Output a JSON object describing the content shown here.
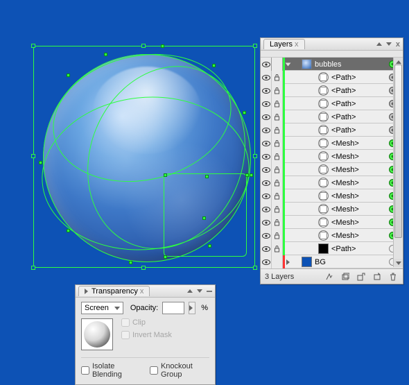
{
  "layers_panel": {
    "title": "Layers",
    "footer_count": "3 Layers",
    "top_layer": {
      "name": "bubbles"
    },
    "sublayers": [
      {
        "name": "<Path>",
        "thumb": "wire",
        "target": "grey"
      },
      {
        "name": "<Path>",
        "thumb": "wire",
        "target": "grey"
      },
      {
        "name": "<Path>",
        "thumb": "wire",
        "target": "grey"
      },
      {
        "name": "<Path>",
        "thumb": "wire",
        "target": "grey"
      },
      {
        "name": "<Path>",
        "thumb": "wire",
        "target": "grey"
      },
      {
        "name": "<Mesh>",
        "thumb": "wire",
        "target": "green"
      },
      {
        "name": "<Mesh>",
        "thumb": "wire",
        "target": "green"
      },
      {
        "name": "<Mesh>",
        "thumb": "wire",
        "target": "green"
      },
      {
        "name": "<Mesh>",
        "thumb": "wire",
        "target": "green"
      },
      {
        "name": "<Mesh>",
        "thumb": "wire",
        "target": "green"
      },
      {
        "name": "<Mesh>",
        "thumb": "wire",
        "target": "green"
      },
      {
        "name": "<Mesh>",
        "thumb": "wire",
        "target": "green"
      },
      {
        "name": "<Mesh>",
        "thumb": "wire",
        "target": "green"
      },
      {
        "name": "<Path>",
        "thumb": "black",
        "target": "hollow"
      }
    ],
    "bg_layer": {
      "name": "BG"
    }
  },
  "transparency_panel": {
    "title": "Transparency",
    "blend_mode": "Screen",
    "opacity_label": "Opacity:",
    "opacity_value": "",
    "opacity_unit": "%",
    "clip_label": "Clip",
    "invert_mask_label": "Invert Mask",
    "isolate_label": "Isolate Blending",
    "knockout_label": "Knockout Group"
  },
  "icons": {
    "close_x": "x"
  }
}
